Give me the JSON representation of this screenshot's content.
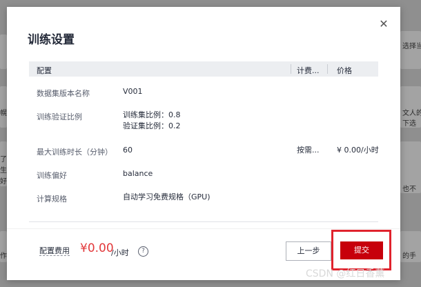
{
  "background": {
    "snippets": [
      "选择当",
      "幌,",
      "了一",
      "生成",
      "好的",
      "作找",
      "文人的",
      "下选",
      "也不",
      "的手"
    ]
  },
  "dialog": {
    "title": "训练设置",
    "close_icon": "close-icon",
    "table": {
      "headers": [
        "配置",
        "计费...",
        "价格"
      ],
      "rows": [
        {
          "label": "数据集版本名称",
          "value": "V001"
        },
        {
          "label": "训练验证比例",
          "value_lines": [
            "训练集比例：0.8",
            "验证集比例：0.2"
          ]
        },
        {
          "label": "最大训练时长（分钟）",
          "value": "60",
          "billing": "按需...",
          "price": "¥ 0.00/小时"
        },
        {
          "label": "训练偏好",
          "value": "balance"
        },
        {
          "label": "计算规格",
          "value": "自动学习免费规格（GPU)"
        }
      ]
    },
    "footer": {
      "fee_label": "配置费用",
      "fee_amount": "¥0.00",
      "fee_unit": "/小时",
      "help_icon": "?",
      "prev_button": "上一步",
      "submit_button": "提交"
    }
  },
  "watermark": "CSDN @红日香薰",
  "colors": {
    "accent": "#c7000b",
    "price": "#e2383a",
    "highlight": "#e0232d"
  }
}
